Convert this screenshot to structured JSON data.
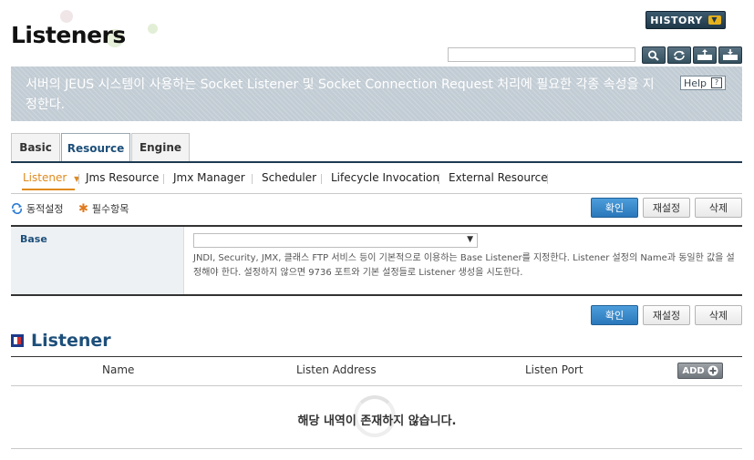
{
  "header": {
    "title": "Listeners",
    "history_label": "HISTORY",
    "search_placeholder": "",
    "tools": [
      "search-icon",
      "refresh-icon",
      "xml-export-icon",
      "xml-import-icon"
    ]
  },
  "banner": {
    "text": "서버의 JEUS 시스템이 사용하는 Socket Listener 및 Socket Connection Request 처리에 필요한 각종 속성을 지정한다.",
    "help_label": "Help"
  },
  "tabs": [
    {
      "label": "Basic",
      "active": false
    },
    {
      "label": "Resource",
      "active": true
    },
    {
      "label": "Engine",
      "active": false
    }
  ],
  "subnav": [
    {
      "label": "Listener",
      "active": true
    },
    {
      "label": "Jms Resource",
      "active": false
    },
    {
      "label": "Jmx Manager",
      "active": false
    },
    {
      "label": "Scheduler",
      "active": false
    },
    {
      "label": "Lifecycle Invocation",
      "active": false
    },
    {
      "label": "External Resource",
      "active": false
    }
  ],
  "legend": {
    "dynamic": "동적설정",
    "required": "필수항목"
  },
  "actions": {
    "confirm": "확인",
    "reset": "재설정",
    "delete": "삭제"
  },
  "form": {
    "base_label": "Base",
    "base_value": "",
    "base_description": "JNDI, Security, JMX, 클래스 FTP 서비스 등이 기본적으로 이용하는 Base Listener를 지정한다. Listener 설정의 Name과 동일한 값을 설정해야 한다. 설정하지 않으면 9736 포트와 기본 설정들로 Listener 생성을 시도한다."
  },
  "listener_section": {
    "title": "Listener",
    "columns": [
      "Name",
      "Listen Address",
      "Listen Port"
    ],
    "add_label": "ADD",
    "empty_message": "해당 내역이 존재하지 않습니다."
  },
  "colors": {
    "accent_blue": "#1d4f7a",
    "primary_button": "#2a78bb",
    "active_subnav": "#e08a1e",
    "banner_bg": "#c2ccd4"
  }
}
